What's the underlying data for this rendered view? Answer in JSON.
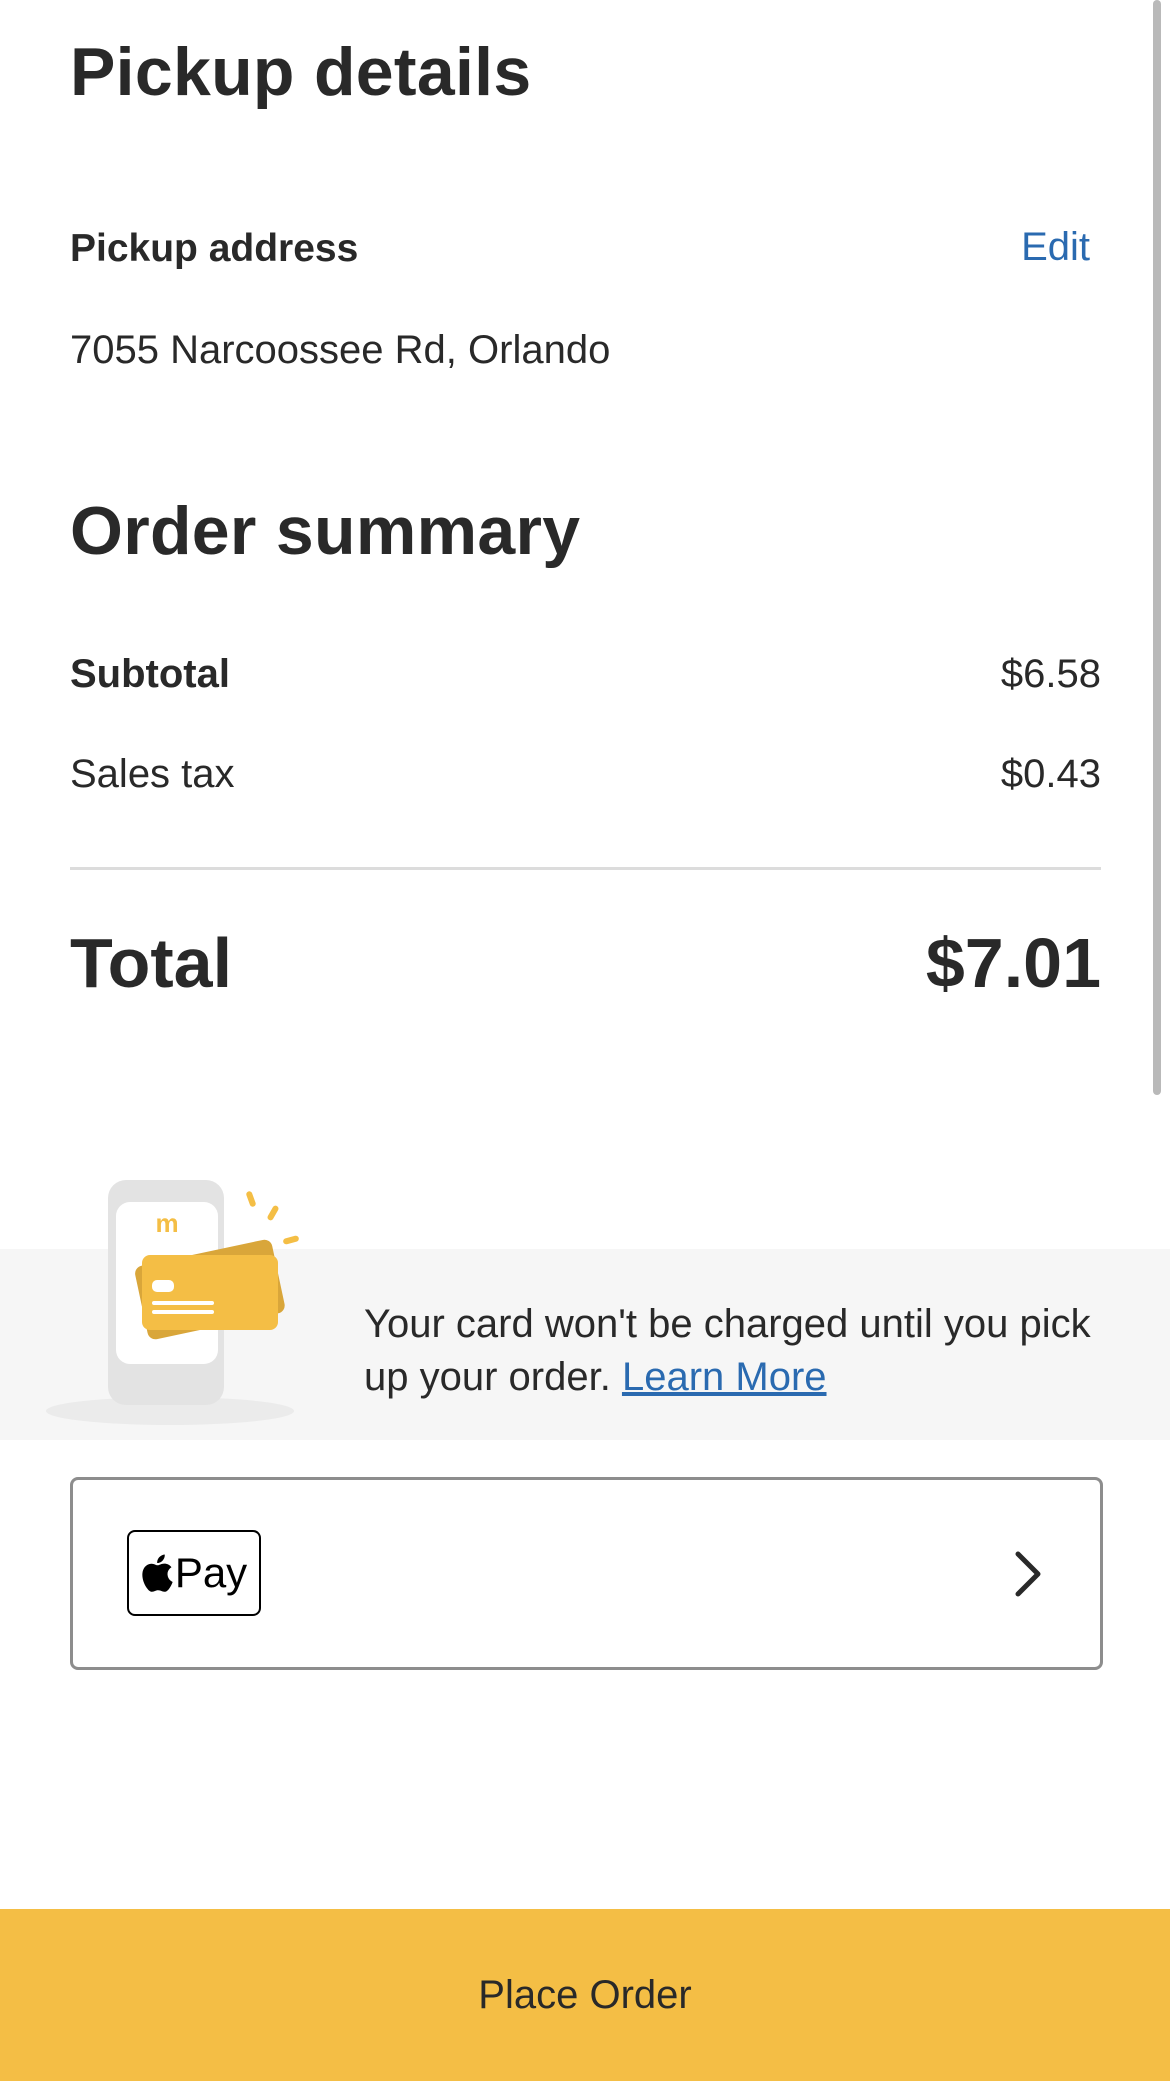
{
  "pickup": {
    "title": "Pickup details",
    "address_label": "Pickup address",
    "edit_label": "Edit",
    "address": "7055 Narcoossee Rd, Orlando"
  },
  "summary": {
    "title": "Order summary",
    "subtotal_label": "Subtotal",
    "subtotal_value": "$6.58",
    "tax_label": "Sales tax",
    "tax_value": "$0.43",
    "total_label": "Total",
    "total_value": "$7.01"
  },
  "info": {
    "text": "Your card won't be charged until you pick up your order.",
    "link_label": "Learn More",
    "illustration_icon": "phone-card-icon",
    "logo_glyph": "m"
  },
  "payment": {
    "method_label": "Pay",
    "apple_icon": "apple-icon",
    "chevron_icon": "chevron-right-icon"
  },
  "footer": {
    "place_order_label": "Place Order"
  },
  "colors": {
    "accent_yellow": "#f4be45",
    "link_blue": "#2a6ab0",
    "text_dark": "#292929",
    "band_gray": "#f6f6f6"
  }
}
